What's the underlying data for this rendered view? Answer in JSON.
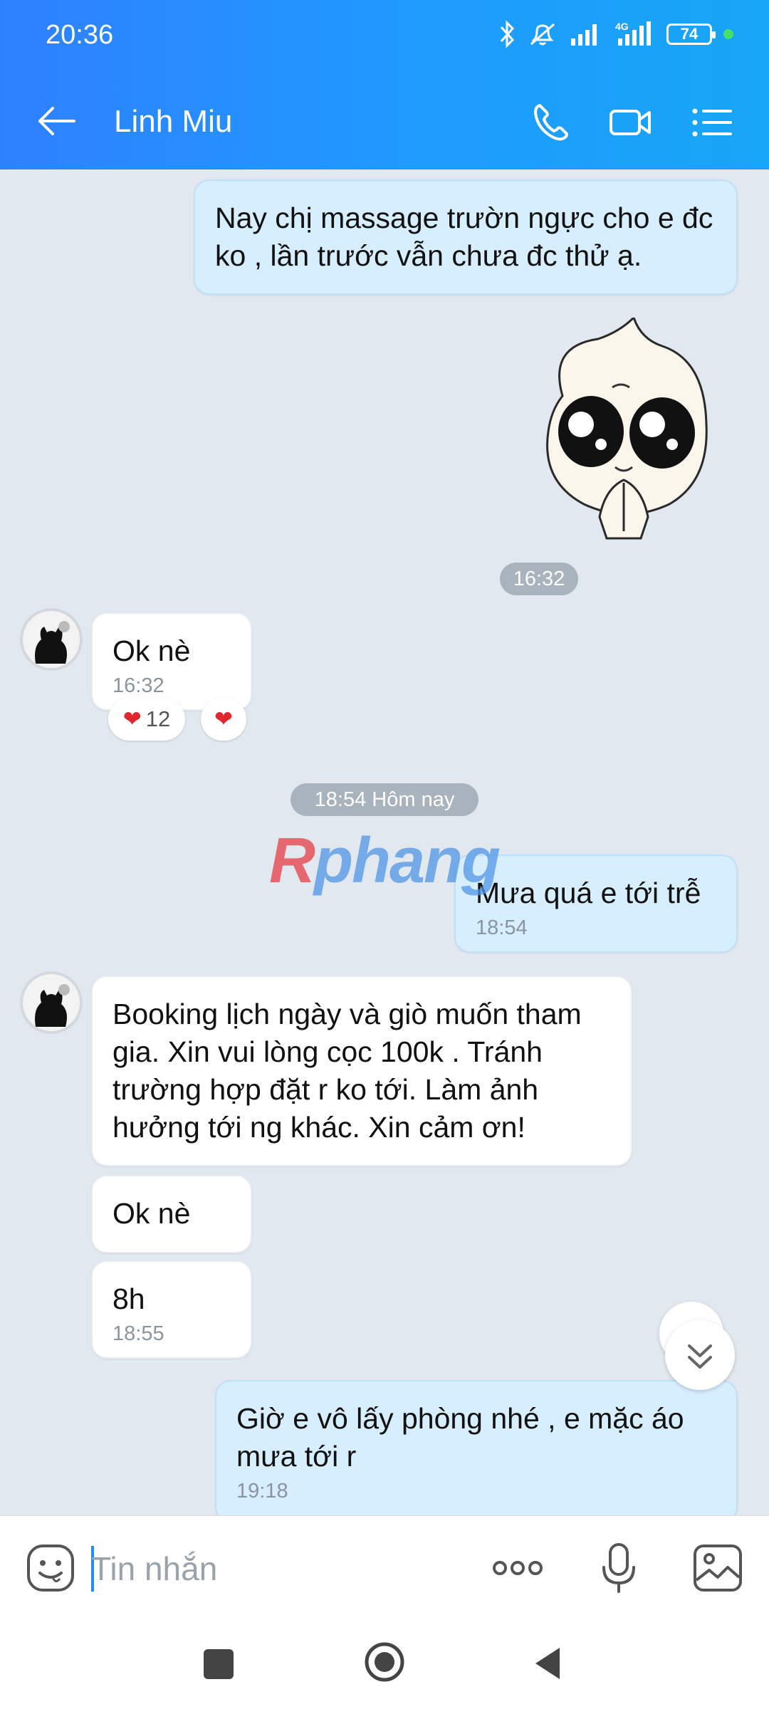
{
  "status_bar": {
    "time": "20:36",
    "battery": "74"
  },
  "header": {
    "contact_name": "Linh Miu"
  },
  "messages": {
    "m1": {
      "text": "Nay chị massage trườn ngực cho e đc ko , lần trước vẫn chưa đc thử ạ."
    },
    "sticker_time": "16:32",
    "m2": {
      "text": "Ok nè",
      "time": "16:32",
      "reaction_count": "12"
    },
    "date_divider": "18:54 Hôm nay",
    "m3": {
      "text": "Mưa quá e tới trễ",
      "time": "18:54"
    },
    "m4": {
      "text": "Booking lịch ngày và giò muốn tham gia. Xin vui lòng cọc 100k . Tránh trường hợp đặt r ko tới. Làm ảnh hưởng tới ng khác. Xin cảm ơn!"
    },
    "m5": {
      "text": "Ok nè"
    },
    "m6": {
      "text": "8h",
      "time": "18:55"
    },
    "m7": {
      "text": "Giờ e vô lấy phòng nhé , e mặc áo mưa tới r",
      "time": "19:18"
    }
  },
  "watermark": {
    "first": "R",
    "rest": "phang"
  },
  "input": {
    "placeholder": "Tin nhắn"
  },
  "colors": {
    "header": "#1f8df5",
    "outgoing_bubble": "#d7eefe",
    "incoming_bubble": "#ffffff",
    "chat_bg": "#e2e8f0"
  },
  "icons": [
    "back-arrow-icon",
    "phone-icon",
    "video-call-icon",
    "menu-list-icon",
    "sticker-emoji-icon",
    "more-options-icon",
    "microphone-icon",
    "gallery-image-icon"
  ]
}
